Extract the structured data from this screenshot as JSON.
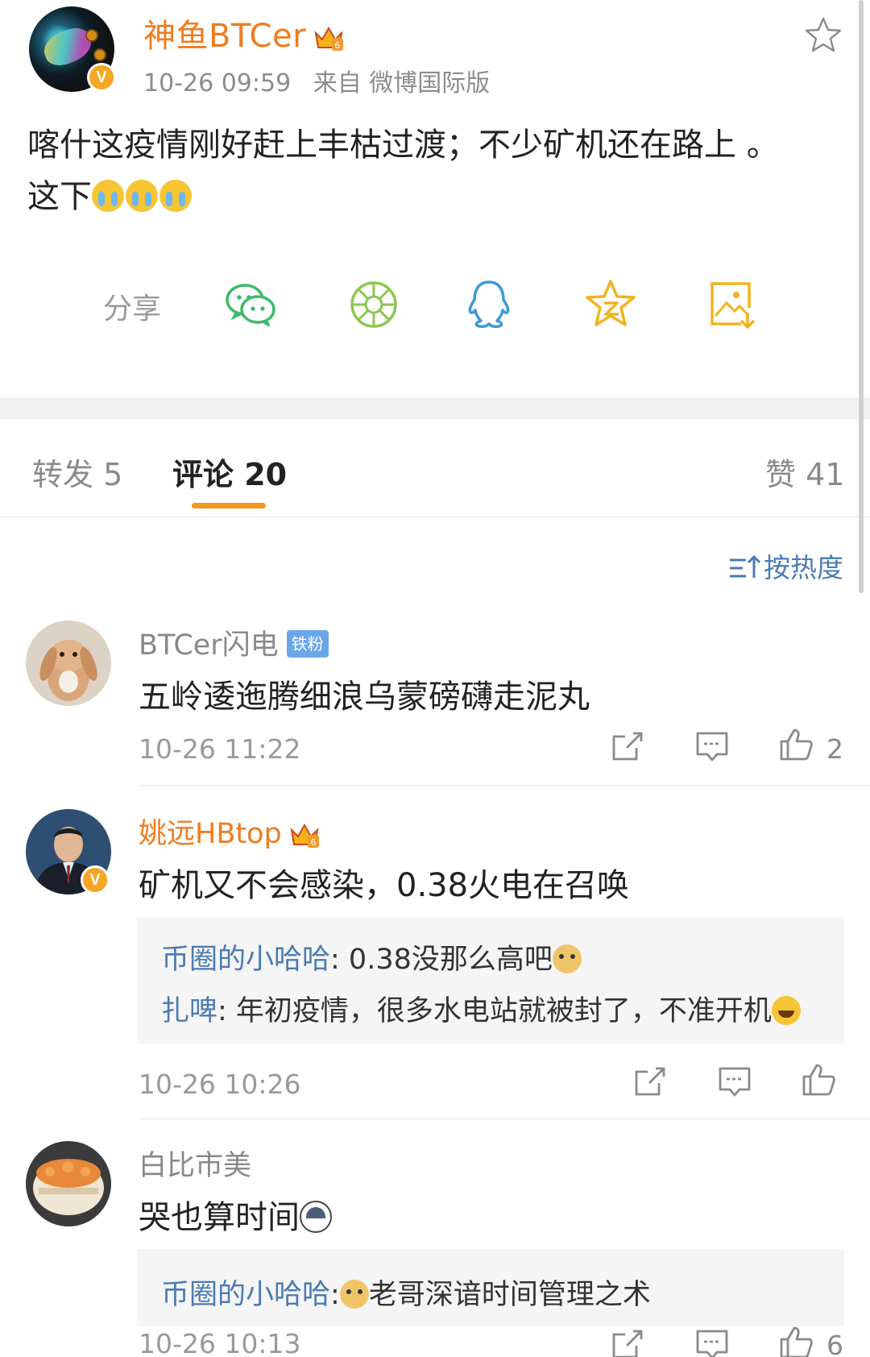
{
  "post": {
    "author": "神鱼BTCer",
    "verified_badge": "V",
    "time": "10-26 09:59",
    "source": "来自 微博国际版",
    "text_line1": "喀什这疫情刚好赶上丰枯过渡；不少矿机还在路上 。",
    "text_line2": "这下",
    "favorite_icon": "star-outline-icon"
  },
  "share": {
    "label": "分享",
    "targets": [
      "wechat-icon",
      "moments-icon",
      "qq-icon",
      "qzone-icon",
      "save-image-icon"
    ]
  },
  "tabs": {
    "repost": "转发 5",
    "comment": "评论 20",
    "like": "赞 41",
    "active": "comment"
  },
  "sort": {
    "label": "按热度"
  },
  "comments": [
    {
      "name": "BTCer闪电",
      "badge": "铁粉",
      "text": "五岭逶迤腾细浪乌蒙磅礴走泥丸",
      "time": "10-26 11:22",
      "likes": "2"
    },
    {
      "name": "姚远HBtop",
      "verified_badge": "V",
      "text": "矿机又不会感染，0.38火电在召唤",
      "replies": [
        {
          "name": "币圈的小哈哈",
          "text": ": 0.38没那么高吧"
        },
        {
          "name": "扎啤",
          "text": ": 年初疫情，很多水电站就被封了，不准开机"
        }
      ],
      "time": "10-26 10:26",
      "likes": ""
    },
    {
      "name": "白比市美",
      "text": "哭也算时间",
      "replies": [
        {
          "name": "币圈的小哈哈",
          "text": ":",
          "text2": "老哥深谙时间管理之术"
        }
      ],
      "time": "10-26 10:13",
      "likes": "6"
    }
  ],
  "colors": {
    "vip_name": "#f07c1e",
    "link_blue": "#4a7bb3",
    "tab_underline": "#f59a1b"
  }
}
